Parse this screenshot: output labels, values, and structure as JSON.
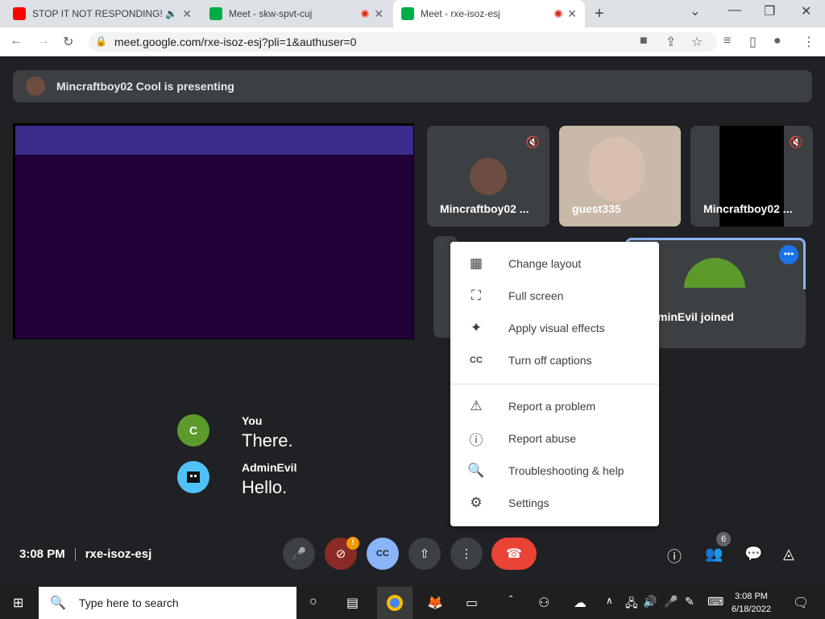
{
  "browser": {
    "tabs": [
      {
        "title": "STOP IT NOT RESPONDING!!",
        "audio": "🔉"
      },
      {
        "title": "Meet - skw-spvt-cuj"
      },
      {
        "title": "Meet - rxe-isoz-esj"
      }
    ],
    "url": "meet.google.com/rxe-isoz-esj?pli=1&authuser=0"
  },
  "meet": {
    "presenting_text": "Mincraftboy02 Cool is presenting",
    "tiles": [
      {
        "name": "Mincraftboy02 ..."
      },
      {
        "name": "guest335"
      },
      {
        "name": "Mincraftboy02 ..."
      }
    ],
    "joined_text": "AdminEvil joined",
    "joined_visible": "minEvil joined",
    "green_avatar_letter": "C",
    "captions": [
      {
        "speaker": "You",
        "text": "There.",
        "avatar_letter": "C",
        "color": "#5c9a2c"
      },
      {
        "speaker": "AdminEvil",
        "text": "Hello.",
        "color": "#4fc3f7"
      }
    ],
    "menu": {
      "items_top": [
        "Change layout",
        "Full screen",
        "Apply visual effects",
        "Turn off captions"
      ],
      "items_bottom": [
        "Report a problem",
        "Report abuse",
        "Troubleshooting & help",
        "Settings"
      ]
    },
    "bottom": {
      "time": "3:08 PM",
      "meeting_code": "rxe-isoz-esj",
      "people_count": "6",
      "camera_alert": "!"
    }
  },
  "taskbar": {
    "search_placeholder": "Type here to search",
    "time": "3:08 PM",
    "date": "6/18/2022"
  }
}
